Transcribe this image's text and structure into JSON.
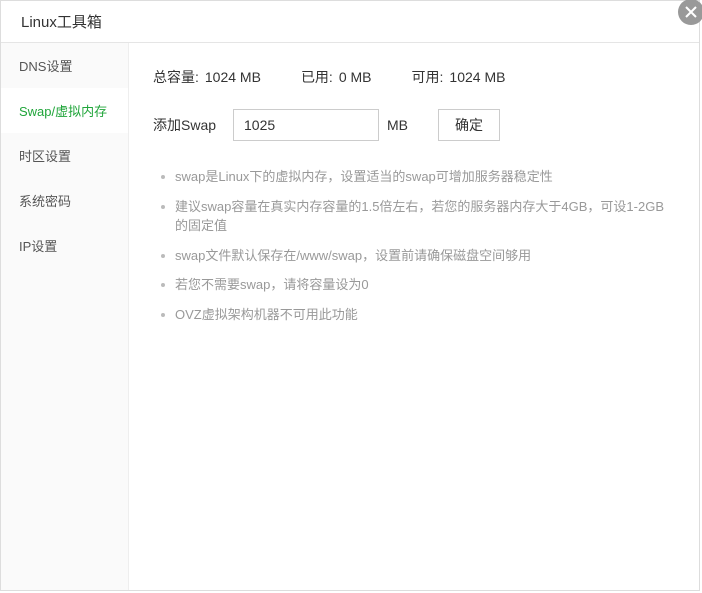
{
  "window": {
    "title": "Linux工具箱"
  },
  "sidebar": {
    "items": [
      {
        "label": "DNS设置"
      },
      {
        "label": "Swap/虚拟内存"
      },
      {
        "label": "时区设置"
      },
      {
        "label": "系统密码"
      },
      {
        "label": "IP设置"
      }
    ],
    "active_index": 1
  },
  "stats": {
    "total_label": "总容量:",
    "total_value": "1024 MB",
    "used_label": "已用:",
    "used_value": "0 MB",
    "avail_label": "可用:",
    "avail_value": "1024 MB"
  },
  "form": {
    "add_label": "添加Swap",
    "input_value": "1025",
    "unit": "MB",
    "confirm_label": "确定"
  },
  "tips": [
    "swap是Linux下的虚拟内存，设置适当的swap可增加服务器稳定性",
    "建议swap容量在真实内存容量的1.5倍左右，若您的服务器内存大于4GB，可设1-2GB的固定值",
    "swap文件默认保存在/www/swap，设置前请确保磁盘空间够用",
    "若您不需要swap，请将容量设为0",
    "OVZ虚拟架构机器不可用此功能"
  ]
}
